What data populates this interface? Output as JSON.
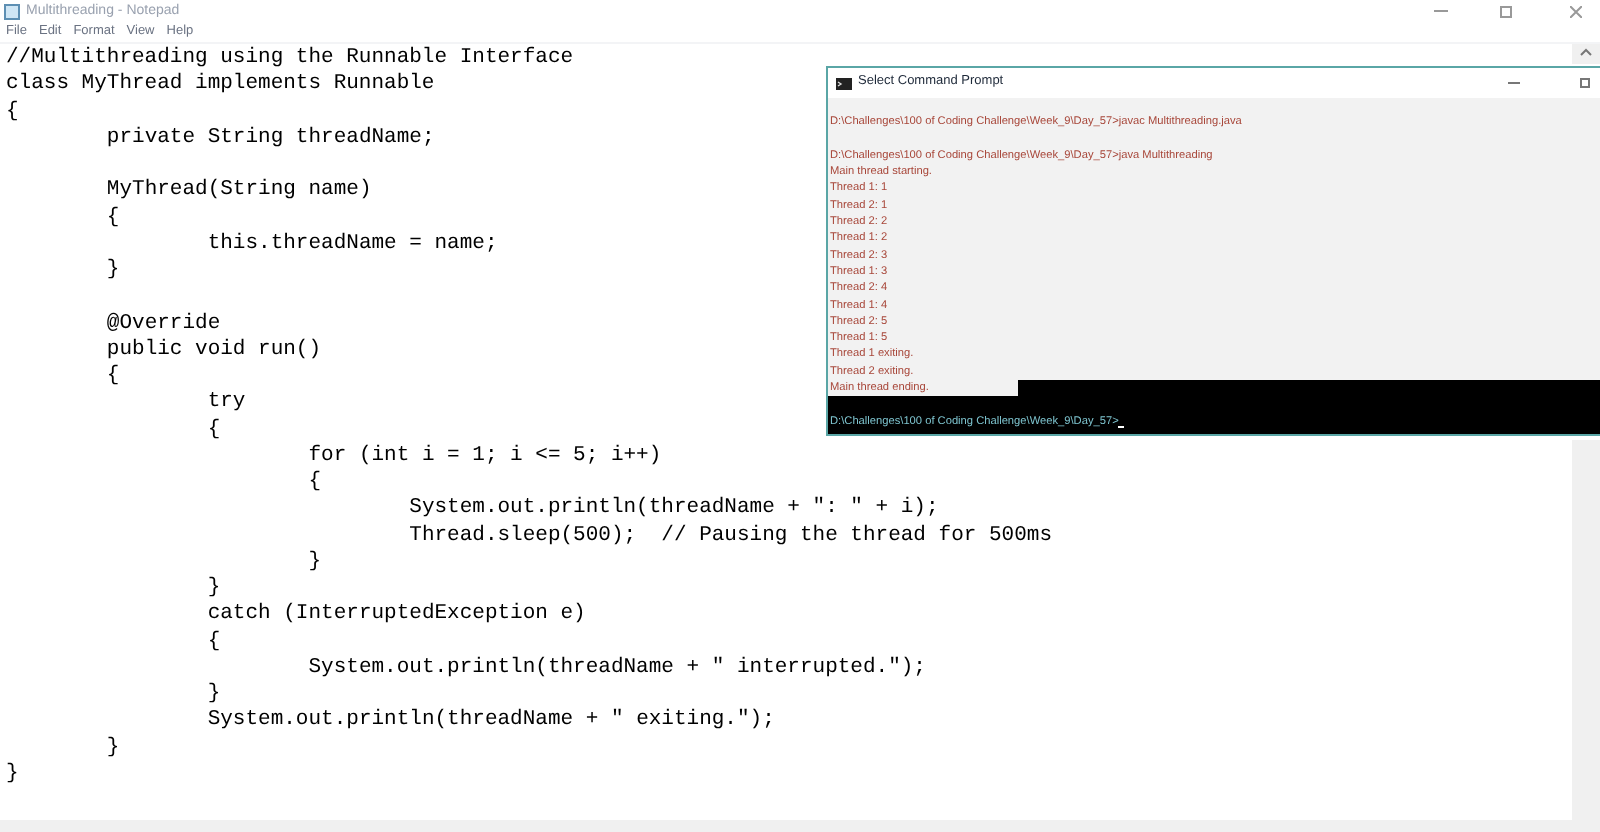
{
  "notepad": {
    "title": "Multithreading - Notepad",
    "menu": [
      "File",
      "Edit",
      "Format",
      "View",
      "Help"
    ],
    "code_blocks": [
      [
        "//Multithreading using the Runnable Interface",
        "class MyThread implements Runnable",
        "{",
        "\tprivate String threadName;"
      ],
      [
        "\tMyThread(String name)",
        "\t{",
        "\t\tthis.threadName = name;",
        "\t}"
      ],
      [
        "\t@Override",
        "\tpublic void run()",
        "\t{",
        "\t\ttry",
        "\t\t{",
        "\t\t\tfor (int i = 1; i <= 5; i++)",
        "\t\t\t{",
        "\t\t\t\tSystem.out.println(threadName + \": \" + i);",
        "\t\t\t\tThread.sleep(500);  // Pausing the thread for 500ms",
        "\t\t\t}",
        "\t\t}",
        "\t\tcatch (InterruptedException e)",
        "\t\t{",
        "\t\t\tSystem.out.println(threadName + \" interrupted.\");",
        "\t\t}",
        "\t\tSystem.out.println(threadName + \" exiting.\");",
        "\t}",
        "}"
      ]
    ]
  },
  "console": {
    "title": "Select Command Prompt",
    "blocks": [
      [
        {
          "text": "D:\\Challenges\\100 of Coding Challenge\\Week_9\\Day_57>javac Multithreading.java",
          "selected": true,
          "partial": false
        }
      ],
      [
        {
          "text": "D:\\Challenges\\100 of Coding Challenge\\Week_9\\Day_57>java Multithreading",
          "selected": true,
          "partial": false
        },
        {
          "text": "Main thread starting.",
          "selected": true,
          "partial": false
        },
        {
          "text": "Thread 1: 1",
          "selected": true,
          "partial": false
        },
        {
          "text": "Thread 2: 1",
          "selected": true,
          "partial": false
        },
        {
          "text": "Thread 2: 2",
          "selected": true,
          "partial": false
        },
        {
          "text": "Thread 1: 2",
          "selected": true,
          "partial": false
        },
        {
          "text": "Thread 2: 3",
          "selected": true,
          "partial": false
        },
        {
          "text": "Thread 1: 3",
          "selected": true,
          "partial": false
        },
        {
          "text": "Thread 2: 4",
          "selected": true,
          "partial": false
        },
        {
          "text": "Thread 1: 4",
          "selected": true,
          "partial": false
        },
        {
          "text": "Thread 2: 5",
          "selected": true,
          "partial": false
        },
        {
          "text": "Thread 1: 5",
          "selected": true,
          "partial": false
        },
        {
          "text": "Thread 1 exiting.",
          "selected": true,
          "partial": false
        },
        {
          "text": "Thread 2 exiting.",
          "selected": true,
          "partial": false
        },
        {
          "text": "Main thread ending.",
          "selected": true,
          "partial": true
        }
      ],
      [
        {
          "text": "D:\\Challenges\\100 of Coding Challenge\\Week_9\\Day_57>",
          "selected": false,
          "cursor": true
        }
      ]
    ]
  }
}
